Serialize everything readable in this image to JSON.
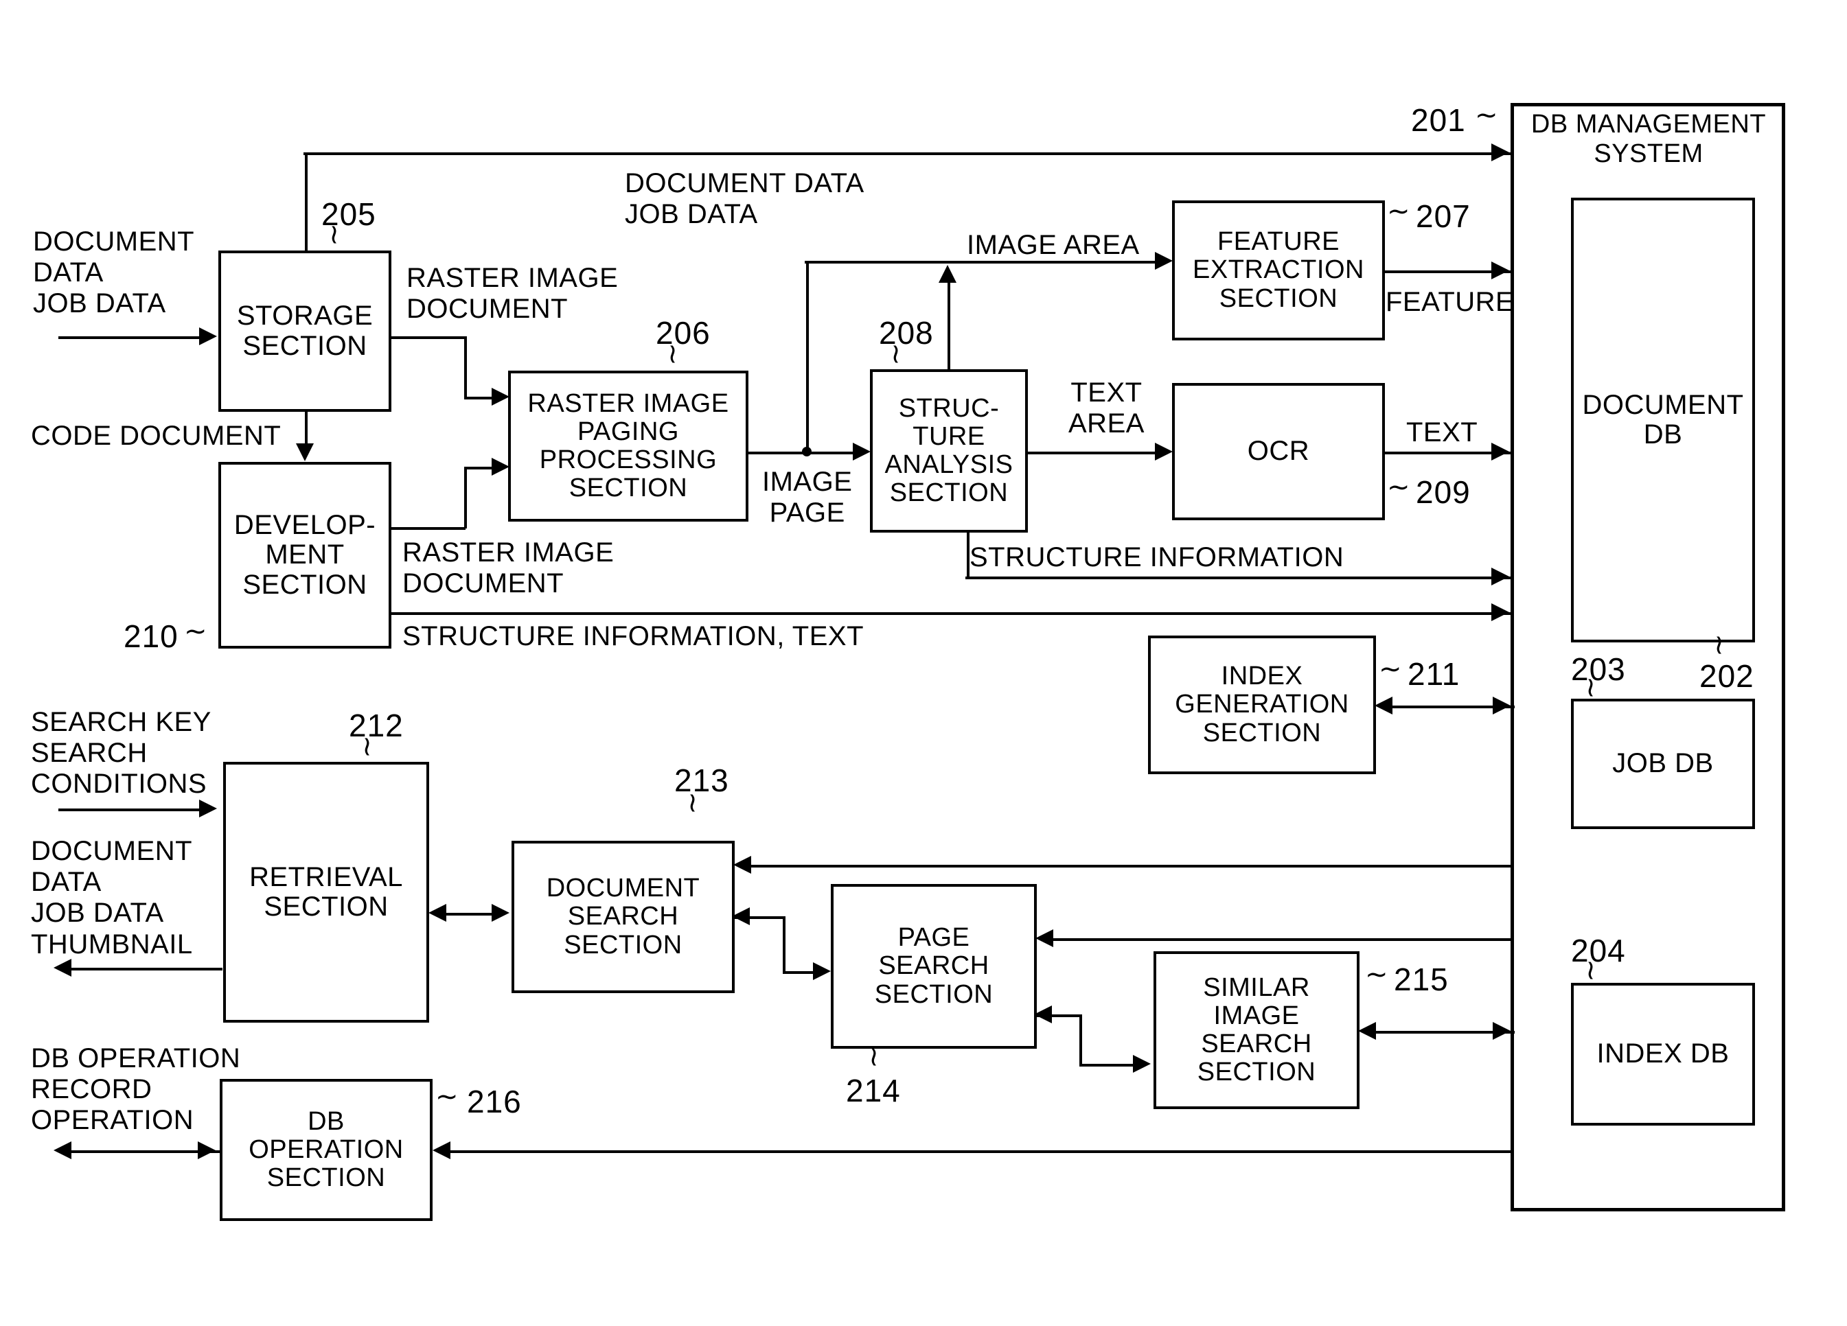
{
  "figure": {
    "type": "patent-block-diagram",
    "title": ""
  },
  "blocks": {
    "storage_section": {
      "label": "STORAGE\nSECTION",
      "ref": "205"
    },
    "development_section": {
      "label": "DEVELOP-\nMENT\nSECTION",
      "ref": "210"
    },
    "raster_paging_section": {
      "label": "RASTER IMAGE\nPAGING\nPROCESSING\nSECTION",
      "ref": "206"
    },
    "structure_analysis_section": {
      "label": "STRUC-\nTURE\nANALYSIS\nSECTION",
      "ref": "208"
    },
    "feature_extraction_section": {
      "label": "FEATURE\nEXTRACTION\nSECTION",
      "ref": "207"
    },
    "ocr_section": {
      "label": "OCR",
      "ref": "209"
    },
    "index_generation_section": {
      "label": "INDEX\nGENERATION\nSECTION",
      "ref": "211"
    },
    "retrieval_section": {
      "label": "RETRIEVAL\nSECTION",
      "ref": "212"
    },
    "document_search_section": {
      "label": "DOCUMENT\nSEARCH\nSECTION",
      "ref": "213"
    },
    "page_search_section": {
      "label": "PAGE\nSEARCH\nSECTION",
      "ref": "214"
    },
    "similar_image_search_section": {
      "label": "SIMILAR\nIMAGE\nSEARCH\nSECTION",
      "ref": "215"
    },
    "db_operation_section": {
      "label": "DB\nOPERATION\nSECTION",
      "ref": "216"
    },
    "db_management_system": {
      "label": "DB MANAGEMENT\nSYSTEM",
      "ref": "201"
    },
    "document_db": {
      "label": "DOCUMENT\nDB",
      "ref": "202"
    },
    "job_db": {
      "label": "JOB DB",
      "ref": "203"
    },
    "index_db": {
      "label": "INDEX DB",
      "ref": "204"
    }
  },
  "edge_labels": {
    "input_document_job": "DOCUMENT\nDATA\nJOB DATA",
    "document_job_top": "DOCUMENT DATA\nJOB DATA",
    "raster_image_document_1": "RASTER IMAGE\nDOCUMENT",
    "raster_image_document_2": "RASTER IMAGE\nDOCUMENT",
    "code_document": "CODE DOCUMENT",
    "image_page": "IMAGE\nPAGE",
    "image_area": "IMAGE AREA",
    "text_area": "TEXT\nAREA",
    "feature": "FEATURE",
    "text": "TEXT",
    "structure_information": "STRUCTURE INFORMATION",
    "structure_information_text": "STRUCTURE INFORMATION, TEXT",
    "search_key_conditions": "SEARCH KEY\nSEARCH\nCONDITIONS",
    "document_data_job_thumbnail": "DOCUMENT\nDATA\nJOB DATA\nTHUMBNAIL",
    "db_operation_record": "DB OPERATION\nRECORD\nOPERATION"
  },
  "refs": {
    "r201": "201",
    "r202": "202",
    "r203": "203",
    "r204": "204",
    "r205": "205",
    "r206": "206",
    "r207": "207",
    "r208": "208",
    "r209": "209",
    "r210": "210",
    "r211": "211",
    "r212": "212",
    "r213": "213",
    "r214": "214",
    "r215": "215",
    "r216": "216"
  },
  "colors": {
    "ink": "#000000",
    "paper": "#ffffff"
  }
}
